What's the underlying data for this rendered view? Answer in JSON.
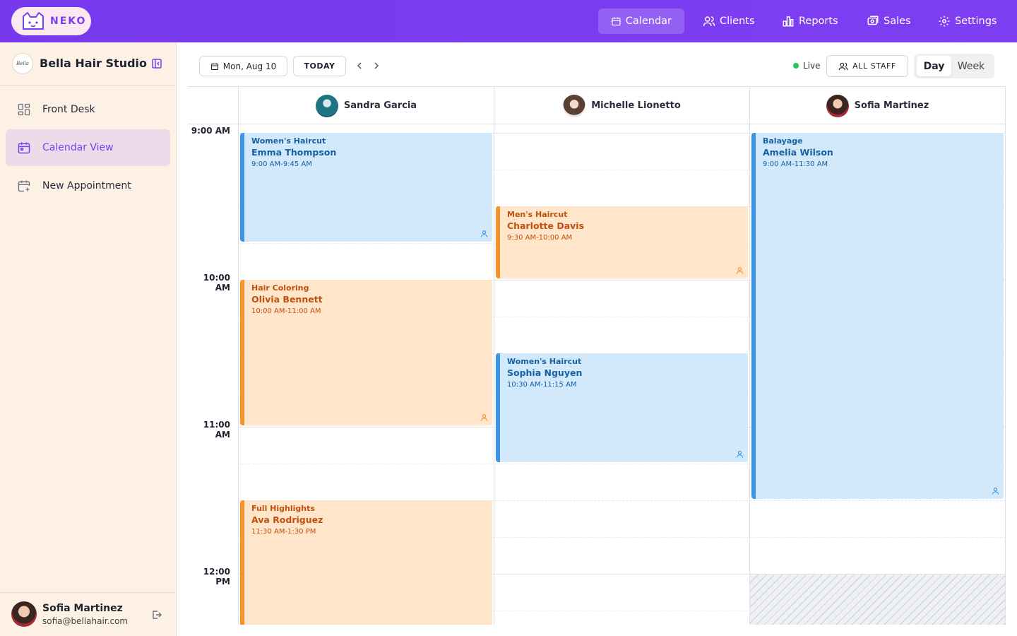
{
  "brand": {
    "name": "NEKO"
  },
  "nav": [
    {
      "label": "Calendar",
      "icon": "calendar-icon",
      "active": true
    },
    {
      "label": "Clients",
      "icon": "users-icon",
      "active": false
    },
    {
      "label": "Reports",
      "icon": "bar-chart-icon",
      "active": false
    },
    {
      "label": "Sales",
      "icon": "register-icon",
      "active": false
    },
    {
      "label": "Settings",
      "icon": "gear-icon",
      "active": false
    }
  ],
  "sidebar": {
    "studio_name": "Bella Hair Studio",
    "studio_logo_text": "Bella",
    "items": [
      {
        "label": "Front Desk",
        "icon": "grid-icon",
        "active": false
      },
      {
        "label": "Calendar View",
        "icon": "calendar-icon",
        "active": true
      },
      {
        "label": "New Appointment",
        "icon": "calendar-plus-icon",
        "active": false
      }
    ],
    "user": {
      "name": "Sofia Martinez",
      "email": "sofia@bellahair.com"
    }
  },
  "toolbar": {
    "date_label": "Mon, Aug 10",
    "today_label": "TODAY",
    "live_label": "Live",
    "staff_filter_label": "ALL STAFF",
    "views": [
      {
        "label": "Day",
        "active": true
      },
      {
        "label": "Week",
        "active": false
      }
    ]
  },
  "calendar": {
    "time_labels": [
      "9:00 AM",
      "10:00 AM",
      "11:00 AM",
      "12:00 PM"
    ],
    "staff": [
      {
        "name": "Sandra Garcia"
      },
      {
        "name": "Michelle Lionetto"
      },
      {
        "name": "Sofia Martinez"
      }
    ],
    "appointments": [
      {
        "staff": 0,
        "service": "Women's Haircut",
        "client": "Emma Thompson",
        "time": "9:00 AM-9:45 AM",
        "color": "blue"
      },
      {
        "staff": 0,
        "service": "Hair Coloring",
        "client": "Olivia Bennett",
        "time": "10:00 AM-11:00 AM",
        "color": "orange"
      },
      {
        "staff": 0,
        "service": "Full Highlights",
        "client": "Ava Rodriguez",
        "time": "11:30 AM-1:30 PM",
        "color": "orange"
      },
      {
        "staff": 1,
        "service": "Men's Haircut",
        "client": "Charlotte Davis",
        "time": "9:30 AM-10:00 AM",
        "color": "orange"
      },
      {
        "staff": 1,
        "service": "Women's Haircut",
        "client": "Sophia Nguyen",
        "time": "10:30 AM-11:15 AM",
        "color": "blue"
      },
      {
        "staff": 2,
        "service": "Balayage",
        "client": "Amelia Wilson",
        "time": "9:00 AM-11:30 AM",
        "color": "blue"
      }
    ],
    "colors": {
      "blue_accent": "#3b94e6",
      "orange_accent": "#f5922b",
      "brand": "#7a3ff0"
    }
  }
}
